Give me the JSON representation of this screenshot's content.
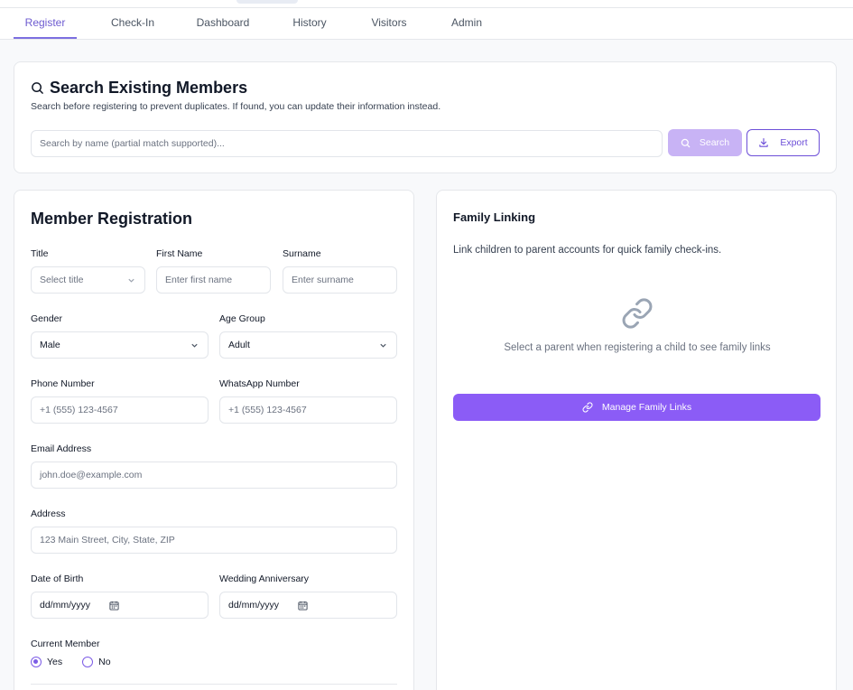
{
  "tabs": [
    {
      "label": "Register",
      "active": true
    },
    {
      "label": "Check-In"
    },
    {
      "label": "Dashboard"
    },
    {
      "label": "History"
    },
    {
      "label": "Visitors"
    },
    {
      "label": "Admin"
    }
  ],
  "search": {
    "title": "Search Existing Members",
    "subtitle": "Search before registering to prevent duplicates. If found, you can update their information instead.",
    "placeholder": "Search by name (partial match supported)...",
    "search_button": "Search",
    "export_button": "Export"
  },
  "registration": {
    "title": "Member Registration",
    "title_label": "Title",
    "title_placeholder": "Select title",
    "first_name_label": "First Name",
    "first_name_placeholder": "Enter first name",
    "surname_label": "Surname",
    "surname_placeholder": "Enter surname",
    "gender_label": "Gender",
    "gender_value": "Male",
    "age_group_label": "Age Group",
    "age_group_value": "Adult",
    "phone_label": "Phone Number",
    "phone_placeholder": "+1 (555) 123-4567",
    "whatsapp_label": "WhatsApp Number",
    "whatsapp_placeholder": "+1 (555) 123-4567",
    "email_label": "Email Address",
    "email_placeholder": "john.doe@example.com",
    "address_label": "Address",
    "address_placeholder": "123 Main Street, City, State, ZIP",
    "dob_label": "Date of Birth",
    "dob_placeholder": "dd/mm/yyyy",
    "anniversary_label": "Wedding Anniversary",
    "anniversary_placeholder": "dd/mm/yyyy",
    "current_member_label": "Current Member",
    "yes_label": "Yes",
    "no_label": "No",
    "current_member_value": "Yes"
  },
  "family": {
    "title": "Family Linking",
    "subtitle": "Link children to parent accounts for quick family check-ins.",
    "empty_text": "Select a parent when registering a child to see family links",
    "button": "Manage Family Links"
  },
  "colors": {
    "accent": "#8b5cf6",
    "accent_light": "#c8b3f5",
    "tab_active": "#6d5bd0"
  }
}
